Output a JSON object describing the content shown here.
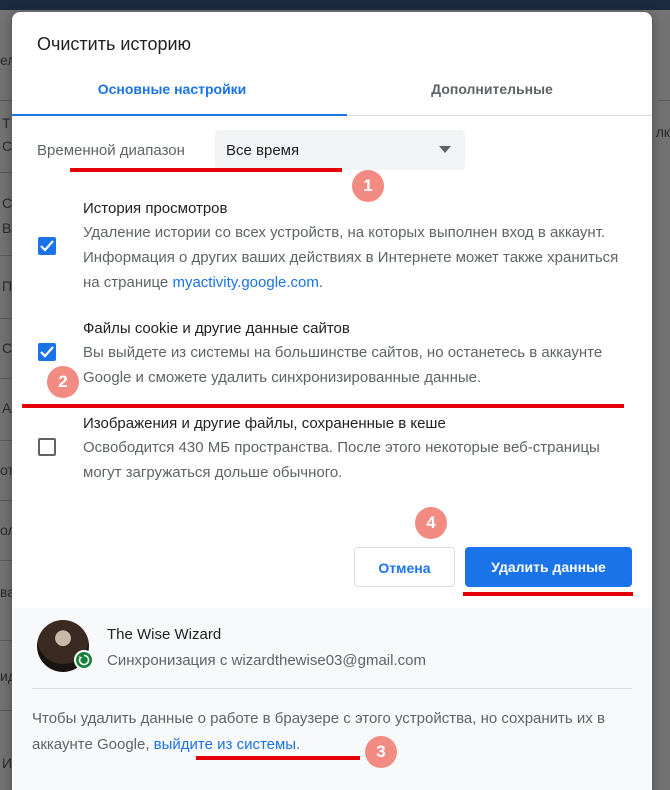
{
  "background": {
    "fragments": [
      "ел",
      "Т",
      "С",
      "С",
      "В",
      "П",
      "С",
      "А",
      "от",
      "ол",
      "ва",
      "ид",
      "И",
      "лк"
    ]
  },
  "dialog": {
    "title": "Очистить историю",
    "tabs": [
      {
        "label": "Основные настройки",
        "active": true
      },
      {
        "label": "Дополнительные",
        "active": false
      }
    ],
    "time_range": {
      "label": "Временной диапазон",
      "selected": "Все время"
    },
    "options": [
      {
        "title": "История просмотров",
        "checked": true,
        "desc_before_link": "Удаление истории со всех устройств, на которых выполнен вход в аккаунт. Информация о других ваших действиях в Интернете может также храниться на странице ",
        "link": "myactivity.google.com",
        "desc_after_link": "."
      },
      {
        "title": "Файлы cookie и другие данные сайтов",
        "checked": true,
        "desc": "Вы выйдете из системы на большинстве сайтов, но останетесь в аккаунте Google и сможете удалить синхронизированные данные."
      },
      {
        "title": "Изображения и другие файлы, сохраненные в кеше",
        "checked": false,
        "desc": "Освободится 430 МБ пространства. После этого некоторые веб-страницы могут загружаться дольше обычного."
      }
    ],
    "buttons": {
      "cancel": "Отмена",
      "delete": "Удалить данные"
    },
    "account": {
      "name": "The Wise Wizard",
      "sync": "Синхронизация с wizardthewise03@gmail.com"
    },
    "footer": {
      "text_before_link": "Чтобы удалить данные о работе в браузере с этого устройства, но сохранить их в аккаунте Google, ",
      "link": "выйдите из системы",
      "text_after_link": "."
    }
  },
  "annotations": {
    "markers": [
      "1",
      "2",
      "3",
      "4"
    ],
    "color": "#e6000a",
    "marker_color": "#f28b82"
  },
  "colors": {
    "accent": "#1a73e8",
    "sync_green": "#188038"
  }
}
